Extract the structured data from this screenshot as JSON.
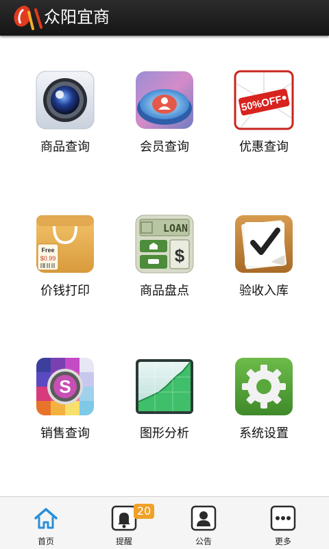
{
  "header": {
    "title": "众阳宜商"
  },
  "grid": {
    "items": [
      {
        "label": "商品查询",
        "icon": "camera-lens-icon"
      },
      {
        "label": "会员查询",
        "icon": "member-profile-icon"
      },
      {
        "label": "优惠查询",
        "icon": "discount-tag-icon"
      },
      {
        "label": "价钱打印",
        "icon": "shopping-bag-price-icon"
      },
      {
        "label": "商品盘点",
        "icon": "calculator-loan-icon"
      },
      {
        "label": "验收入库",
        "icon": "checkmark-note-icon"
      },
      {
        "label": "销售查询",
        "icon": "colorful-s-icon"
      },
      {
        "label": "图形分析",
        "icon": "area-chart-icon"
      },
      {
        "label": "系统设置",
        "icon": "settings-gear-icon"
      }
    ],
    "icon_texts": {
      "discount": "50%OFF",
      "tag_free": "Free",
      "tag_price": "$0.99",
      "loan": "LOAN"
    }
  },
  "tabbar": {
    "tabs": [
      {
        "label": "首页",
        "icon": "home-icon",
        "active": true
      },
      {
        "label": "提醒",
        "icon": "bell-icon",
        "badge": "20"
      },
      {
        "label": "公告",
        "icon": "person-card-icon"
      },
      {
        "label": "更多",
        "icon": "more-dots-icon"
      }
    ]
  },
  "colors": {
    "titlebar": "#1e1e1e",
    "tab_active": "#2a8fd8",
    "badge": "#f0a12a"
  }
}
